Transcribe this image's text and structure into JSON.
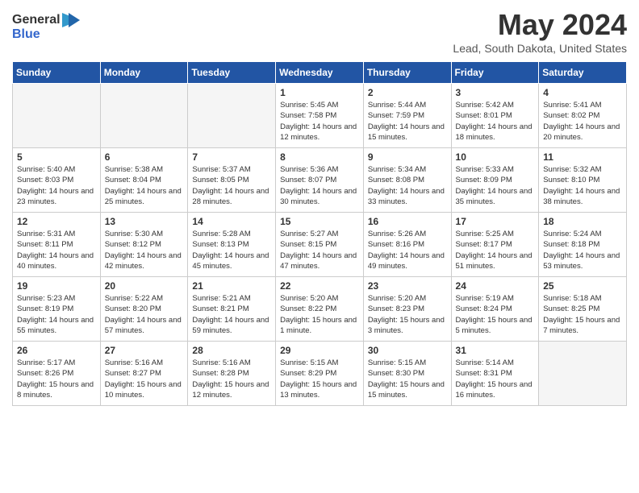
{
  "header": {
    "logo_general": "General",
    "logo_blue": "Blue",
    "month_year": "May 2024",
    "location": "Lead, South Dakota, United States"
  },
  "weekdays": [
    "Sunday",
    "Monday",
    "Tuesday",
    "Wednesday",
    "Thursday",
    "Friday",
    "Saturday"
  ],
  "weeks": [
    [
      {
        "day": "",
        "info": ""
      },
      {
        "day": "",
        "info": ""
      },
      {
        "day": "",
        "info": ""
      },
      {
        "day": "1",
        "info": "Sunrise: 5:45 AM\nSunset: 7:58 PM\nDaylight: 14 hours\nand 12 minutes."
      },
      {
        "day": "2",
        "info": "Sunrise: 5:44 AM\nSunset: 7:59 PM\nDaylight: 14 hours\nand 15 minutes."
      },
      {
        "day": "3",
        "info": "Sunrise: 5:42 AM\nSunset: 8:01 PM\nDaylight: 14 hours\nand 18 minutes."
      },
      {
        "day": "4",
        "info": "Sunrise: 5:41 AM\nSunset: 8:02 PM\nDaylight: 14 hours\nand 20 minutes."
      }
    ],
    [
      {
        "day": "5",
        "info": "Sunrise: 5:40 AM\nSunset: 8:03 PM\nDaylight: 14 hours\nand 23 minutes."
      },
      {
        "day": "6",
        "info": "Sunrise: 5:38 AM\nSunset: 8:04 PM\nDaylight: 14 hours\nand 25 minutes."
      },
      {
        "day": "7",
        "info": "Sunrise: 5:37 AM\nSunset: 8:05 PM\nDaylight: 14 hours\nand 28 minutes."
      },
      {
        "day": "8",
        "info": "Sunrise: 5:36 AM\nSunset: 8:07 PM\nDaylight: 14 hours\nand 30 minutes."
      },
      {
        "day": "9",
        "info": "Sunrise: 5:34 AM\nSunset: 8:08 PM\nDaylight: 14 hours\nand 33 minutes."
      },
      {
        "day": "10",
        "info": "Sunrise: 5:33 AM\nSunset: 8:09 PM\nDaylight: 14 hours\nand 35 minutes."
      },
      {
        "day": "11",
        "info": "Sunrise: 5:32 AM\nSunset: 8:10 PM\nDaylight: 14 hours\nand 38 minutes."
      }
    ],
    [
      {
        "day": "12",
        "info": "Sunrise: 5:31 AM\nSunset: 8:11 PM\nDaylight: 14 hours\nand 40 minutes."
      },
      {
        "day": "13",
        "info": "Sunrise: 5:30 AM\nSunset: 8:12 PM\nDaylight: 14 hours\nand 42 minutes."
      },
      {
        "day": "14",
        "info": "Sunrise: 5:28 AM\nSunset: 8:13 PM\nDaylight: 14 hours\nand 45 minutes."
      },
      {
        "day": "15",
        "info": "Sunrise: 5:27 AM\nSunset: 8:15 PM\nDaylight: 14 hours\nand 47 minutes."
      },
      {
        "day": "16",
        "info": "Sunrise: 5:26 AM\nSunset: 8:16 PM\nDaylight: 14 hours\nand 49 minutes."
      },
      {
        "day": "17",
        "info": "Sunrise: 5:25 AM\nSunset: 8:17 PM\nDaylight: 14 hours\nand 51 minutes."
      },
      {
        "day": "18",
        "info": "Sunrise: 5:24 AM\nSunset: 8:18 PM\nDaylight: 14 hours\nand 53 minutes."
      }
    ],
    [
      {
        "day": "19",
        "info": "Sunrise: 5:23 AM\nSunset: 8:19 PM\nDaylight: 14 hours\nand 55 minutes."
      },
      {
        "day": "20",
        "info": "Sunrise: 5:22 AM\nSunset: 8:20 PM\nDaylight: 14 hours\nand 57 minutes."
      },
      {
        "day": "21",
        "info": "Sunrise: 5:21 AM\nSunset: 8:21 PM\nDaylight: 14 hours\nand 59 minutes."
      },
      {
        "day": "22",
        "info": "Sunrise: 5:20 AM\nSunset: 8:22 PM\nDaylight: 15 hours\nand 1 minute."
      },
      {
        "day": "23",
        "info": "Sunrise: 5:20 AM\nSunset: 8:23 PM\nDaylight: 15 hours\nand 3 minutes."
      },
      {
        "day": "24",
        "info": "Sunrise: 5:19 AM\nSunset: 8:24 PM\nDaylight: 15 hours\nand 5 minutes."
      },
      {
        "day": "25",
        "info": "Sunrise: 5:18 AM\nSunset: 8:25 PM\nDaylight: 15 hours\nand 7 minutes."
      }
    ],
    [
      {
        "day": "26",
        "info": "Sunrise: 5:17 AM\nSunset: 8:26 PM\nDaylight: 15 hours\nand 8 minutes."
      },
      {
        "day": "27",
        "info": "Sunrise: 5:16 AM\nSunset: 8:27 PM\nDaylight: 15 hours\nand 10 minutes."
      },
      {
        "day": "28",
        "info": "Sunrise: 5:16 AM\nSunset: 8:28 PM\nDaylight: 15 hours\nand 12 minutes."
      },
      {
        "day": "29",
        "info": "Sunrise: 5:15 AM\nSunset: 8:29 PM\nDaylight: 15 hours\nand 13 minutes."
      },
      {
        "day": "30",
        "info": "Sunrise: 5:15 AM\nSunset: 8:30 PM\nDaylight: 15 hours\nand 15 minutes."
      },
      {
        "day": "31",
        "info": "Sunrise: 5:14 AM\nSunset: 8:31 PM\nDaylight: 15 hours\nand 16 minutes."
      },
      {
        "day": "",
        "info": ""
      }
    ]
  ]
}
